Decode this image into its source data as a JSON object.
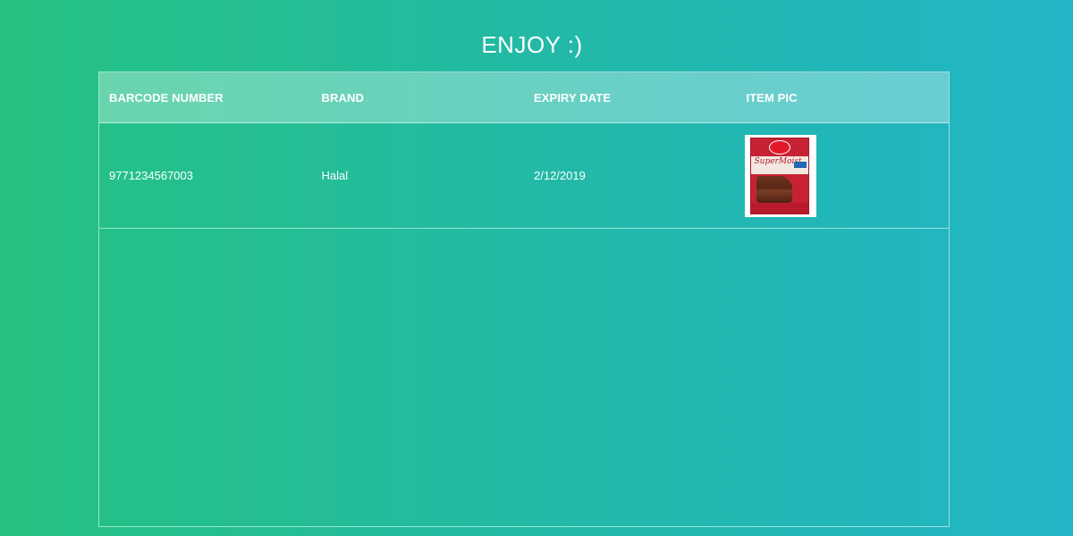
{
  "page": {
    "title": "ENJOY :)"
  },
  "table": {
    "columns": [
      "BARCODE NUMBER",
      "BRAND",
      "EXPIRY DATE",
      "ITEM PIC"
    ],
    "rows": [
      {
        "barcode": "9771234567003",
        "brand": "Halal",
        "expiry": "2/12/2019",
        "pic": "cake-mix-box-image"
      }
    ]
  },
  "colors": {
    "gradient_start": "#25c281",
    "gradient_end": "#22b5c6",
    "text": "#ffffff"
  }
}
